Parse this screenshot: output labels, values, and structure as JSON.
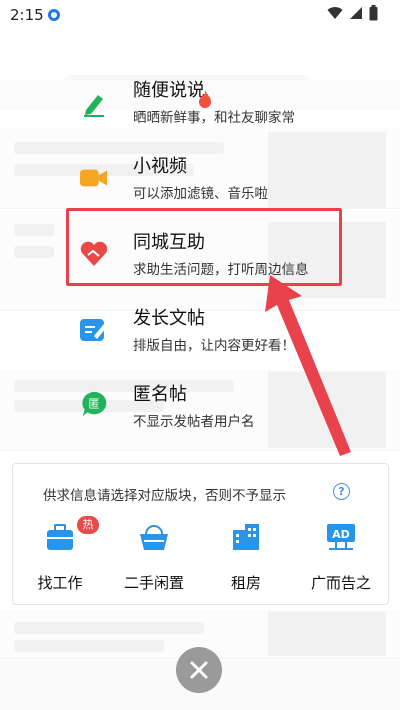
{
  "status_bar": {
    "time": "2:15"
  },
  "menu": [
    {
      "title": "随便说说",
      "subtitle": "晒晒新鲜事，和社友聊家常",
      "icon": "pencil-icon",
      "color": "#22b35a"
    },
    {
      "title": "小视频",
      "subtitle": "可以添加滤镜、音乐啦",
      "icon": "video-camera-icon",
      "color": "#f5a623",
      "badge_icon": "fire-icon"
    },
    {
      "title": "同城互助",
      "subtitle": "求助生活问题，打听周边信息",
      "icon": "heart-hands-icon",
      "color": "#ea4a45"
    },
    {
      "title": "发长文帖",
      "subtitle": "排版自由，让内容更好看！",
      "icon": "edit-document-icon",
      "color": "#2a95e8"
    },
    {
      "title": "匿名帖",
      "subtitle": "不显示发帖者用户名",
      "icon": "anonymous-chat-icon",
      "color": "#22b35a",
      "icon_text": "匿"
    }
  ],
  "panel": {
    "note": "供求信息请选择对应版块，否则不予显示",
    "categories": [
      {
        "label": "找工作",
        "icon": "briefcase-icon",
        "badge": "热"
      },
      {
        "label": "二手闲置",
        "icon": "basket-icon"
      },
      {
        "label": "租房",
        "icon": "building-icon"
      },
      {
        "label": "广而告之",
        "icon": "ad-sign-icon",
        "icon_text": "AD"
      }
    ]
  },
  "colors": {
    "accent": "#2a95e8",
    "highlight": "#e8424c"
  }
}
